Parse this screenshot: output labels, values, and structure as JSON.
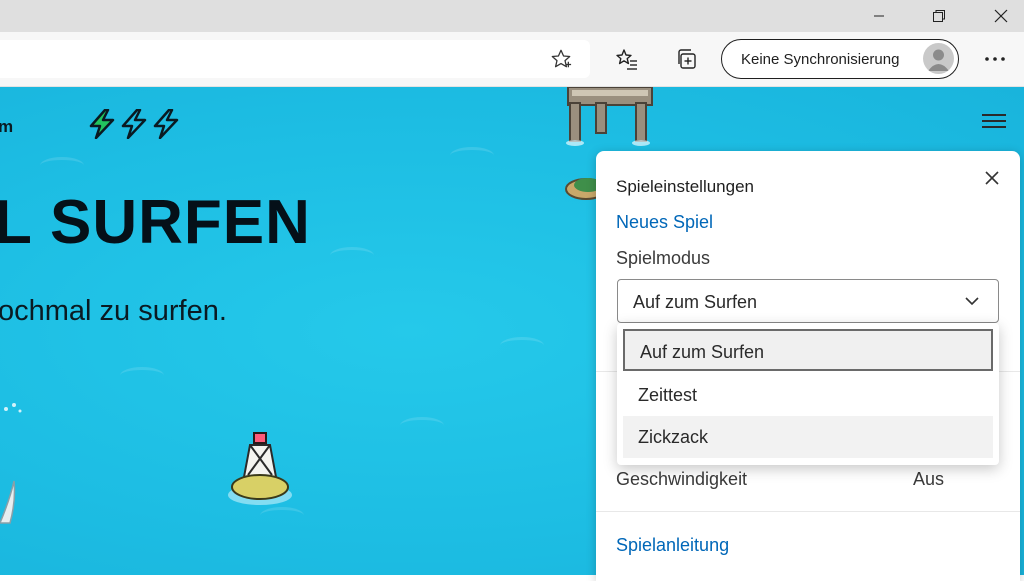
{
  "browser": {
    "sync_label": "Keine Synchronisierung",
    "more_label": "···",
    "icons": [
      "minimize-icon",
      "restore-icon",
      "close-icon",
      "favorite-star-icon",
      "favorites-list-icon",
      "collections-icon",
      "profile-avatar-icon",
      "more-icon"
    ]
  },
  "game": {
    "brand": "m",
    "lives_icon": "lightning-bolt-icon",
    "lives_count": 3,
    "hero_title": "L SURFEN",
    "hero_subtitle": "ochmal zu surfen."
  },
  "settings": {
    "title": "Spieleinstellungen",
    "new_game": "Neues Spiel",
    "mode_label": "Spielmodus",
    "mode_value": "Auf zum Surfen",
    "mode_options": [
      "Auf zum Surfen",
      "Zeittest",
      "Zickzack"
    ],
    "speed_label": "Geschwindigkeit",
    "speed_value": "Aus",
    "instructions": "Spielanleitung"
  },
  "colors": {
    "ocean": "#1dbde3",
    "link": "#0067b8",
    "bolt": "#22c55e"
  }
}
